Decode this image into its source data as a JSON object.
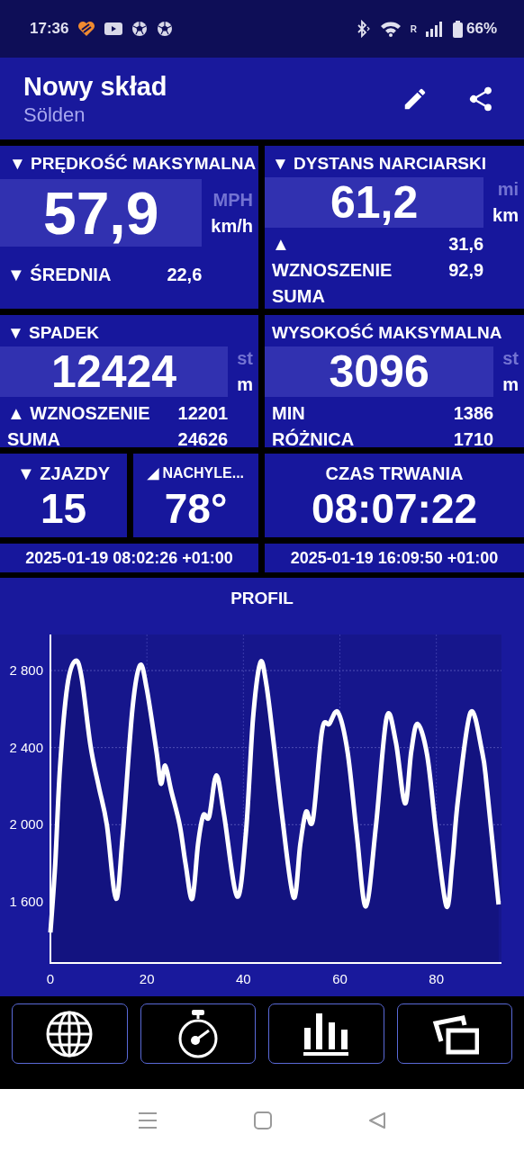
{
  "status_bar": {
    "time": "17:36",
    "network": "R",
    "battery": "66%"
  },
  "app_bar": {
    "title": "Nowy skład",
    "subtitle": "Sölden"
  },
  "stat_cards": [
    {
      "marker": "▼",
      "title": "PRĘDKOŚĆ MAKSYMALNA",
      "value": "57,9",
      "kind": "primary",
      "units": [
        {
          "label": "MPH",
          "selected": false
        },
        {
          "label": "km/h",
          "selected": true
        }
      ],
      "details": [
        {
          "marker": "▼",
          "label": "ŚREDNIA",
          "value": "22,6"
        }
      ]
    },
    {
      "marker": "▼",
      "title": "DYSTANS NARCIARSKI",
      "value": "61,2",
      "kind": "secondary",
      "units": [
        {
          "label": "mi",
          "selected": false
        },
        {
          "label": "km",
          "selected": true
        }
      ],
      "details": [
        {
          "marker": "▲",
          "value": "31,6"
        },
        {
          "label": "WZNOSZENIE",
          "value": "92,9"
        },
        {
          "label": "SUMA"
        }
      ]
    },
    {
      "marker": "▼",
      "title": "SPADEK",
      "value": "12424",
      "kind": "secondary",
      "units": [
        {
          "label": "st",
          "selected": false
        },
        {
          "label": "m",
          "selected": true
        }
      ],
      "details": [
        {
          "marker": "▲",
          "label": "WZNOSZENIE",
          "value": "12201"
        },
        {
          "label": "SUMA",
          "value": "24626"
        }
      ]
    },
    {
      "title": "WYSOKOŚĆ MAKSYMALNA",
      "value": "3096",
      "kind": "secondary",
      "units": [
        {
          "label": "st",
          "selected": false
        },
        {
          "label": "m",
          "selected": true
        }
      ],
      "details": [
        {
          "label": "MIN",
          "value": "1386"
        },
        {
          "label": "RÓŻNICA",
          "value": "1710"
        }
      ]
    }
  ],
  "small_cards": [
    {
      "marker": "▼",
      "title": "ZJAZDY",
      "value": "15"
    },
    {
      "marker": "◢",
      "title": "NACHYLE...",
      "value": "78°"
    }
  ],
  "duration": {
    "title": "CZAS TRWANIA",
    "value": "08:07:22"
  },
  "start_time": "2025-01-19 08:02:26 +01:00",
  "end_time": "2025-01-19 16:09:50 +01:00",
  "profile": {
    "chart_data": {
      "type": "area",
      "title": "PROFIL",
      "grid": true,
      "xlim": [
        0,
        93.5
      ],
      "ylim": [
        1282,
        2987
      ],
      "xticks": [
        0,
        20,
        40,
        60,
        80
      ],
      "yticks": [
        {
          "value": 1600,
          "label": "1 600"
        },
        {
          "value": 2000,
          "label": "2 000"
        },
        {
          "value": 2400,
          "label": "2 400"
        },
        {
          "value": 2800,
          "label": "2 800"
        }
      ],
      "x": [
        0,
        1,
        2,
        3.5,
        5.2,
        6.5,
        8.3,
        10,
        11.7,
        13.6,
        15,
        17,
        18.6,
        20,
        22,
        22.9,
        23.8,
        25,
        26.8,
        28,
        29.4,
        30.6,
        31.7,
        32.9,
        34.4,
        36,
        38.7,
        40.5,
        42,
        43.5,
        44.7,
        46.1,
        48,
        50.4,
        51.8,
        53,
        54.4,
        56.3,
        57.8,
        59.6,
        61.6,
        63.5,
        65.4,
        67.5,
        69.7,
        71.6,
        73.5,
        74.8,
        76.1,
        78.1,
        80,
        82.1,
        83.3,
        84.5,
        87.1,
        89.5,
        90.5,
        92.9
      ],
      "series": [
        {
          "color": "#ffffff",
          "values": [
            1440,
            1800,
            2300,
            2720,
            2850,
            2760,
            2411,
            2200,
            1998,
            1615,
            1950,
            2600,
            2828,
            2700,
            2376,
            2213,
            2307,
            2180,
            1998,
            1800,
            1615,
            1900,
            2049,
            2041,
            2256,
            2050,
            1627,
            1950,
            2550,
            2841,
            2738,
            2462,
            2050,
            1622,
            1900,
            2067,
            2024,
            2488,
            2523,
            2583,
            2376,
            1950,
            1576,
            2000,
            2557,
            2428,
            2110,
            2380,
            2523,
            2359,
            1950,
            1576,
            1800,
            2135,
            2583,
            2376,
            2187,
            1585
          ]
        }
      ]
    }
  }
}
